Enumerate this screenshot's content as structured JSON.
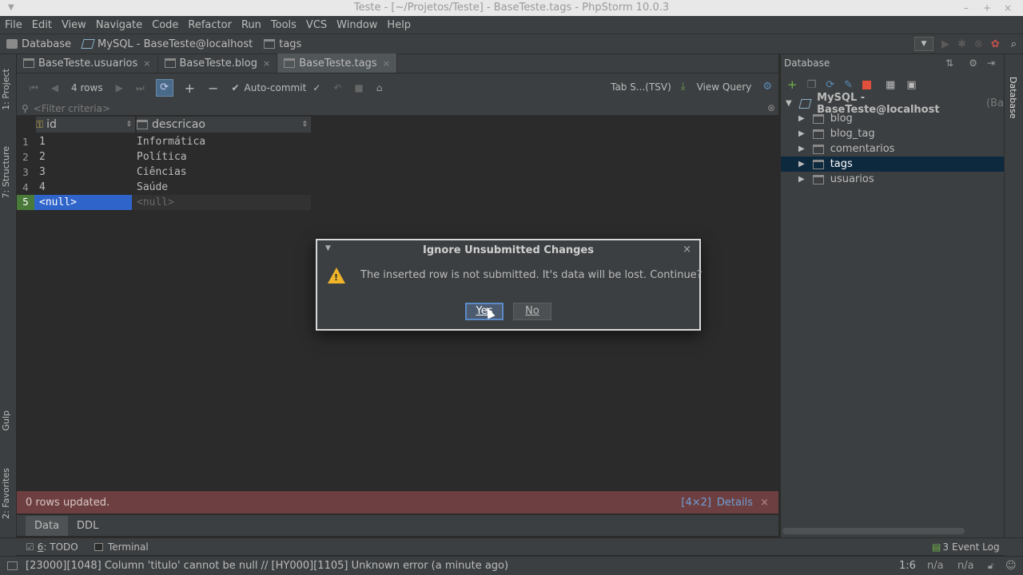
{
  "window": {
    "title": "Teste - [~/Projetos/Teste] - BaseTeste.tags - PhpStorm 10.0.3",
    "min_glyph": "–",
    "max_glyph": "+",
    "close_glyph": "×"
  },
  "menu": [
    "File",
    "Edit",
    "View",
    "Navigate",
    "Code",
    "Refactor",
    "Run",
    "Tools",
    "VCS",
    "Window",
    "Help"
  ],
  "breadcrumbs": [
    "Database",
    "MySQL - BaseTeste@localhost",
    "tags"
  ],
  "left_tool_windows": [
    "1: Project",
    "7: Structure",
    "Gulp",
    "2: Favorites"
  ],
  "editor_tabs": [
    {
      "label": "BaseTeste.usuarios",
      "close": "×"
    },
    {
      "label": "BaseTeste.blog",
      "close": "×"
    },
    {
      "label": "BaseTeste.tags",
      "close": "×"
    }
  ],
  "data_toolbar": {
    "row_count": "4 rows",
    "add": "+",
    "remove": "−",
    "autocommit": "Auto-commit",
    "format": "Tab S...(TSV)",
    "view_query": "View Query"
  },
  "filter": {
    "placeholder": "<Filter criteria>"
  },
  "grid": {
    "columns": [
      "id",
      "descricao"
    ],
    "rows": [
      {
        "num": "1",
        "id": "1",
        "descricao": "Informática"
      },
      {
        "num": "2",
        "id": "2",
        "descricao": "Política"
      },
      {
        "num": "3",
        "id": "3",
        "descricao": "Ciências"
      },
      {
        "num": "4",
        "id": "4",
        "descricao": "Saúde"
      },
      {
        "num": "5",
        "id": "<null>",
        "descricao": "<null>"
      }
    ]
  },
  "status_message": {
    "text": "0 rows updated.",
    "dims": "[4×2]",
    "details": "Details",
    "close": "×"
  },
  "bottom_tabs": [
    "Data",
    "DDL"
  ],
  "tool_windows_bottom": {
    "todo_num": "6",
    "todo": ": TODO",
    "terminal": "Terminal",
    "event_log": "Event Log",
    "event_count": "3"
  },
  "status_bar": {
    "message": "[23000][1048] Column 'titulo' cannot be null // [HY000][1105] Unknown error (a minute ago)",
    "position": "1:6",
    "na1": "n/a",
    "na2": "n/a"
  },
  "database_panel": {
    "title": "Database",
    "right_strip_label": "Database",
    "connection": "MySQL - BaseTeste@localhost",
    "connection_suffix": "(Ba",
    "tables": [
      "blog",
      "blog_tag",
      "comentarios",
      "tags",
      "usuarios"
    ],
    "selected_table": "tags"
  },
  "dialog": {
    "title": "Ignore Unsubmitted Changes",
    "message": "The inserted row is not submitted. It's data will be lost. Continue?",
    "yes": "Yes",
    "no": "No",
    "close": "×"
  },
  "colors": {
    "error_banner": "#6e3f40",
    "selection": "#2f65ca",
    "selected_row_num": "#4a7a3a",
    "tree_selection": "#0d293e"
  }
}
